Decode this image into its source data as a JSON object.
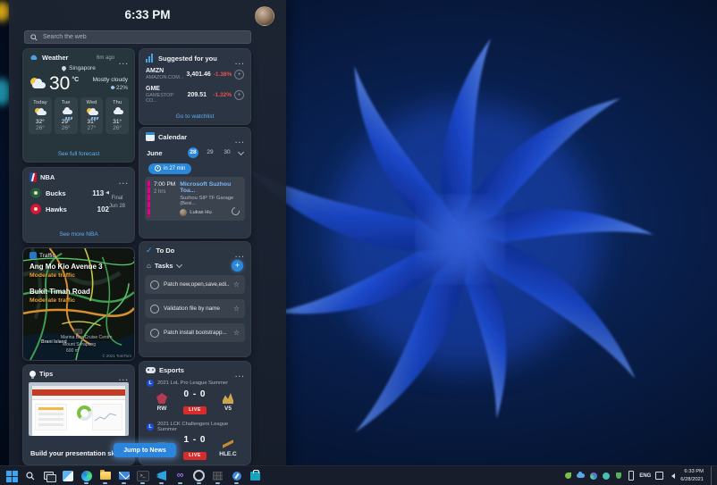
{
  "panel": {
    "time": "6:33 PM",
    "search_placeholder": "Search the web",
    "jump_button": "Jump to News"
  },
  "weather": {
    "title": "Weather",
    "updated": "6m ago",
    "location": "Singapore",
    "temperature": "30",
    "unit": "°C",
    "condition": "Mostly cloudy",
    "precipitation": "22%",
    "forecast": [
      {
        "day": "Today",
        "icon": "partly-sunny",
        "high": "32°",
        "low": "26°"
      },
      {
        "day": "Tue",
        "icon": "rain",
        "high": "29°",
        "low": "26°"
      },
      {
        "day": "Wed",
        "icon": "rain-sun",
        "high": "31°",
        "low": "27°"
      },
      {
        "day": "Thu",
        "icon": "cloudy",
        "high": "31°",
        "low": "26°"
      }
    ],
    "link": "See full forecast"
  },
  "stocks": {
    "title": "Suggested for you",
    "rows": [
      {
        "symbol": "AMZN",
        "company": "AMAZON.COM...",
        "price": "3,401.46",
        "change": "-1.38%"
      },
      {
        "symbol": "GME",
        "company": "GAMESTOP CO...",
        "price": "209.51",
        "change": "-1.32%"
      }
    ],
    "link": "Go to watchlist"
  },
  "calendar": {
    "title": "Calendar",
    "month": "June",
    "days": [
      "28",
      "29",
      "30"
    ],
    "selected_day": "28",
    "reminder": "in 27 min",
    "event": {
      "time": "7:00 PM",
      "duration": "2 hrs",
      "title": "Microsoft Suzhou Toa...",
      "location": "Suzhou SIP TF Garage (Besi...",
      "attendee": "Lukas Hu"
    }
  },
  "nba": {
    "title": "NBA",
    "teams": [
      {
        "name": "Bucks",
        "score": "113"
      },
      {
        "name": "Hawks",
        "score": "102"
      }
    ],
    "status": "Final",
    "date": "Jun 28",
    "link": "See more NBA"
  },
  "traffic": {
    "title": "Traffic,",
    "roads": [
      {
        "name": "Ang Mo Kio Avenue 3",
        "status": "Moderate traffic"
      },
      {
        "name": "Bukit Timah Road",
        "status": "Moderate traffic"
      }
    ],
    "map_labels": [
      "Brani Island",
      "Marina Bay Cruise Centre",
      "Mount Serapong",
      "600 m"
    ],
    "attribution": "© 2021 TomTom"
  },
  "todo": {
    "title": "To Do",
    "list_name": "Tasks",
    "tasks": [
      {
        "text": "Patch new,open,save,edi..."
      },
      {
        "text": "Validation file by name"
      },
      {
        "text": "Patch install bootstrapp..."
      }
    ]
  },
  "tips": {
    "title": "Tips",
    "caption": "Build your presentation skills"
  },
  "esports": {
    "title": "Esports",
    "matches": [
      {
        "league": "2021 LoL Pro League Summer",
        "left": "RW",
        "right": "V5",
        "score": "0 - 0",
        "badge": "LIVE"
      },
      {
        "league": "2021 LCK Challengers League Summer",
        "left": "",
        "right": "HLE.C",
        "score": "1 - 0",
        "badge": "LIVE"
      }
    ]
  },
  "taskbar": {
    "language": "ENG",
    "clock_time": "6:33 PM",
    "clock_date": "6/28/2021",
    "icons": [
      "start",
      "search",
      "task-view",
      "widgets",
      "edge",
      "file-explorer",
      "mail",
      "terminal",
      "vscode",
      "visual-studio",
      "settings",
      "office",
      "feedback-hub",
      "store"
    ]
  },
  "colors": {
    "accent": "#2b88d8",
    "link_blue": "#61aef0",
    "negative_red": "#e8514c",
    "live_red": "#d92b2b",
    "event_bar_magenta": "#e3008c",
    "traffic_moderate": "#e8a33d"
  }
}
